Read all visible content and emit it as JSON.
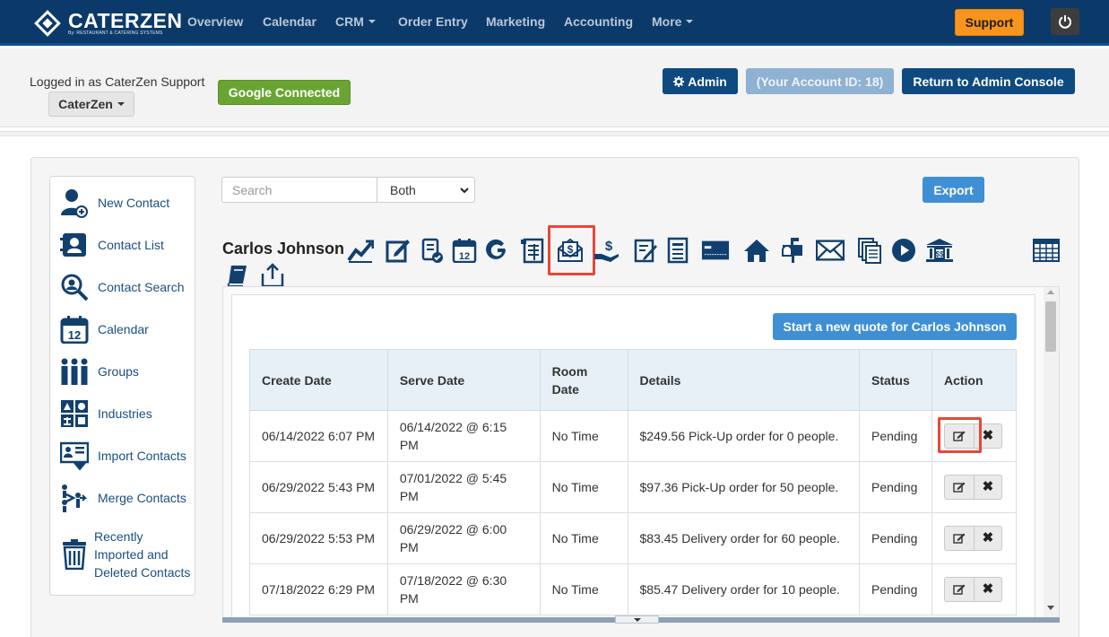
{
  "brand": {
    "name": "CATERZEN",
    "tagline": "By: RESTAURANT & CATERING SYSTEMS"
  },
  "nav": {
    "overview": "Overview",
    "calendar": "Calendar",
    "crm": "CRM",
    "order_entry": "Order Entry",
    "marketing": "Marketing",
    "accounting": "Accounting",
    "more": "More",
    "support": "Support"
  },
  "header": {
    "logged_in": "Logged in as CaterZen Support",
    "account": "CaterZen",
    "google": "Google Connected",
    "admin": "Admin",
    "account_id": "(Your Account ID: 18)",
    "return": "Return to Admin Console"
  },
  "sidebar": {
    "items": [
      {
        "label": "New Contact",
        "icon": "new-contact-icon"
      },
      {
        "label": "Contact List",
        "icon": "contact-list-icon"
      },
      {
        "label": "Contact Search",
        "icon": "contact-search-icon"
      },
      {
        "label": "Calendar",
        "icon": "calendar-icon"
      },
      {
        "label": "Groups",
        "icon": "groups-icon"
      },
      {
        "label": "Industries",
        "icon": "industries-icon"
      },
      {
        "label": "Import Contacts",
        "icon": "import-contacts-icon"
      },
      {
        "label": "Merge Contacts",
        "icon": "merge-contacts-icon"
      },
      {
        "label": "Recently Imported and Deleted Contacts",
        "icon": "trash-icon"
      }
    ]
  },
  "search": {
    "placeholder": "Search",
    "scope": "Both",
    "export": "Export"
  },
  "contact": {
    "name": "Carlos Johnson"
  },
  "quote_button": "Start a new quote for Carlos Johnson",
  "table": {
    "headers": [
      "Create Date",
      "Serve Date",
      "Room Date",
      "Details",
      "Status",
      "Action"
    ],
    "rows": [
      {
        "create": "06/14/2022 6:07 PM",
        "serve": "06/14/2022 @ 6:15 PM",
        "room": "No Time",
        "details": "$249.56 Pick-Up order for 0 people.",
        "status": "Pending"
      },
      {
        "create": "06/29/2022 5:43 PM",
        "serve": "07/01/2022 @ 5:45 PM",
        "room": "No Time",
        "details": "$97.36 Pick-Up order for 50 people.",
        "status": "Pending"
      },
      {
        "create": "06/29/2022 5:53 PM",
        "serve": "06/29/2022 @ 6:00 PM",
        "room": "No Time",
        "details": "$83.45 Delivery order for 60 people.",
        "status": "Pending"
      },
      {
        "create": "07/18/2022 6:29 PM",
        "serve": "07/18/2022 @ 6:30 PM",
        "room": "No Time",
        "details": "$85.47 Delivery order for 10 people.",
        "status": "Pending"
      }
    ]
  },
  "colors": {
    "navy": "#0b3a6a",
    "accent_blue": "#3f8fd4",
    "orange": "#f7941d",
    "green": "#6aa533",
    "highlight": "#e8463a",
    "link": "#1a4f7f"
  }
}
